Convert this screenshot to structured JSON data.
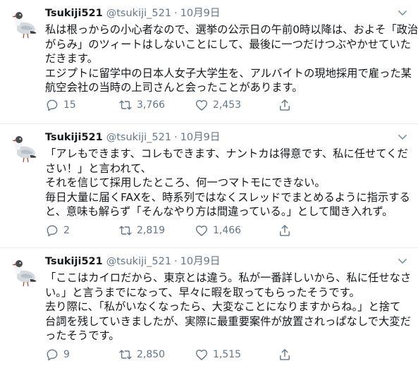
{
  "colors": {
    "text": "#14171a",
    "muted": "#657786",
    "divider": "#e6ecf0"
  },
  "icons": {
    "avatar": "seagull-avatar-icon",
    "caret": "chevron-down-icon",
    "reply": "reply-icon",
    "retweet": "retweet-icon",
    "like": "heart-icon",
    "share": "share-icon"
  },
  "tweets": [
    {
      "name": "Tsukiji521",
      "handle": "@tsukiji_521",
      "separator": "·",
      "date": "10月9日",
      "lines": [
        "私は根っからの小心者なので、選挙の公示日の午前0時以降は、およそ「政治",
        "がらみ」のツィートはしないことにして、最後に一つだけつぶやかせていた",
        "だきます。",
        "エジプトに留学中の日本人女子大学生を、アルバイトの現地採用で雇った某",
        "航空会社の当時の上司さんと会ったことがあります。"
      ],
      "replies": "15",
      "retweets": "3,766",
      "likes": "2,453"
    },
    {
      "name": "Tsukiji521",
      "handle": "@tsukiji_521",
      "separator": "·",
      "date": "10月9日",
      "lines": [
        "「アレもできます、コレもできます、ナントカは得意です、私に任せてくだ",
        "さい！」と言われて、",
        "それを信じて採用したところ、何一つマトモにできない。",
        "毎日大量に届くFAXを、時系列ではなくスレッドでまとめるように指示する",
        "と、意味も解らず「そんなやり方は間違っている。」として聞き入れず。"
      ],
      "replies": "2",
      "retweets": "2,819",
      "likes": "1,466"
    },
    {
      "name": "Tsukiji521",
      "handle": "@tsukiji_521",
      "separator": "·",
      "date": "10月9日",
      "lines": [
        "「ここはカイロだから、東京とは違う。私が一番詳しいから、私に任せなさ",
        "い。」と言うまでになって、早々に暇を取ってもらったそうです。",
        "去り際に、「私がいなくなったら、大変なことになりますからね。」と捨て",
        "台詞を残していきましたが、実際に最重要案件が放置されっぱなしで大変だ",
        "ったそうです。"
      ],
      "replies": "9",
      "retweets": "2,850",
      "likes": "1,515"
    }
  ]
}
